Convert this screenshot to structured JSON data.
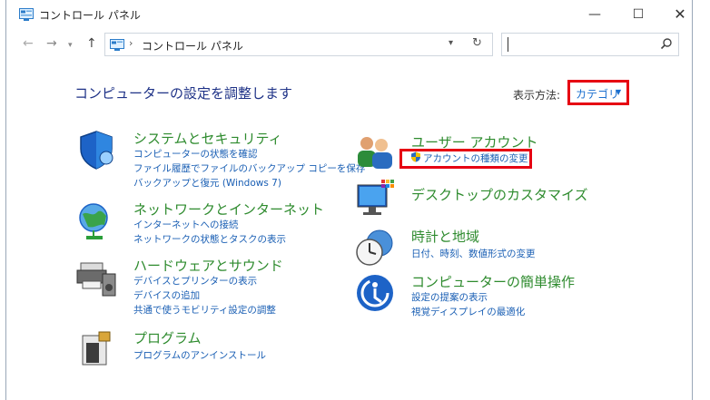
{
  "window": {
    "title": "コントロール パネル",
    "controls": {
      "minimize": "—",
      "maximize": "☐",
      "close": "✕"
    }
  },
  "nav": {
    "back": "←",
    "forward": "→",
    "recent": "▾",
    "up": "↑",
    "address_separator": "›",
    "address_text": "コントロール パネル",
    "address_dropdown": "▾",
    "refresh": "↻",
    "search_value": ""
  },
  "header": {
    "title": "コンピューターの設定を調整します",
    "view_by_label": "表示方法:",
    "view_by_value": "カテゴリ",
    "view_by_arrow": "▼"
  },
  "categories_left": [
    {
      "title": "システムとセキュリティ",
      "icon": "shield-icon",
      "links": [
        "コンピューターの状態を確認",
        "ファイル履歴でファイルのバックアップ コピーを保存",
        "バックアップと復元 (Windows 7)"
      ]
    },
    {
      "title": "ネットワークとインターネット",
      "icon": "network-globe-icon",
      "links": [
        "インターネットへの接続",
        "ネットワークの状態とタスクの表示"
      ]
    },
    {
      "title": "ハードウェアとサウンド",
      "icon": "printer-speaker-icon",
      "links": [
        "デバイスとプリンターの表示",
        "デバイスの追加",
        "共通で使うモビリティ設定の調整"
      ]
    },
    {
      "title": "プログラム",
      "icon": "programs-icon",
      "links": [
        "プログラムのアンインストール"
      ]
    }
  ],
  "categories_right": [
    {
      "title": "ユーザー アカウント",
      "icon": "users-icon",
      "links": [
        "アカウントの種類の変更"
      ]
    },
    {
      "title": "デスクトップのカスタマイズ",
      "icon": "monitor-icon",
      "links": []
    },
    {
      "title": "時計と地域",
      "icon": "clock-globe-icon",
      "links": [
        "日付、時刻、数値形式の変更"
      ]
    },
    {
      "title": "コンピューターの簡単操作",
      "icon": "accessibility-icon",
      "links": [
        "設定の提案の表示",
        "視覚ディスプレイの最適化"
      ]
    }
  ],
  "colors": {
    "category_title": "#2e8b2e",
    "link": "#1a5fb4",
    "heading": "#1e3287",
    "highlight": "#e60012"
  }
}
